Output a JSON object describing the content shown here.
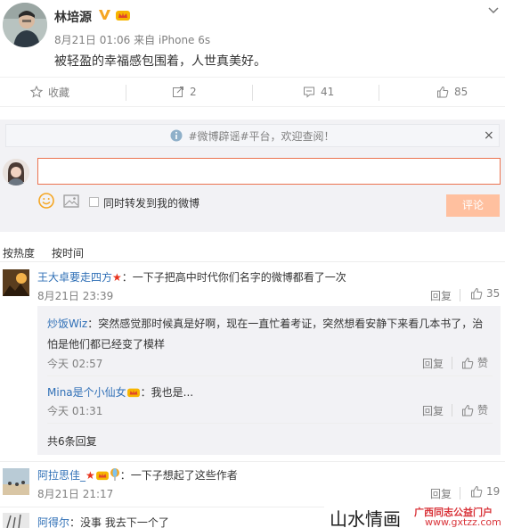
{
  "post": {
    "author": "林培源",
    "meta": "8月21日 01:06 来自 iPhone 6s",
    "text": "被轻盈的幸福感包围着，人世真美好。"
  },
  "actions": {
    "favorite": "收藏",
    "repost": "2",
    "comment": "41",
    "like": "85"
  },
  "notice": {
    "text": "#微博辟谣#平台，欢迎查阅！",
    "close": "×"
  },
  "composer": {
    "input_value": "",
    "forward_label": "同时转发到我的微博",
    "submit_label": "评论"
  },
  "sort_tabs": {
    "hot": "按热度",
    "time": "按时间"
  },
  "comments": [
    {
      "user": "王大卓要走四方",
      "text": "：一下子把高中时代你们名字的微博都看了一次",
      "time": "8月21日 23:39",
      "reply": "回复",
      "likes": "35",
      "replies": [
        {
          "user": "炒饭Wiz",
          "text_line1": "：突然感觉那时候真是好啊，现在一直忙着考证，突然想看安静下来看几本书了，治",
          "text_line2": "怕是他们都已经变了模样",
          "time": "今天 02:57",
          "reply": "回复",
          "likes": "赞"
        },
        {
          "user": "Mina是个小仙女",
          "text": "：我也是...",
          "time": "今天 01:31",
          "reply": "回复",
          "likes": "赞"
        }
      ],
      "more_replies": "共6条回复"
    },
    {
      "user": "阿拉思佳_",
      "text": "：一下子想起了这些作者",
      "time": "8月21日 21:17",
      "reply": "回复",
      "likes": "19"
    },
    {
      "user": "阿得尔",
      "text": "：没事 我去下一个了"
    }
  ],
  "watermark": {
    "main": "山水情画",
    "sub1": "广西同志公益门户",
    "sub2": "www.gxtzz.com"
  },
  "colors": {
    "accent": "#eb7350",
    "link": "#2f6fb6",
    "muted": "#808080",
    "panel": "#f2f2f5"
  }
}
